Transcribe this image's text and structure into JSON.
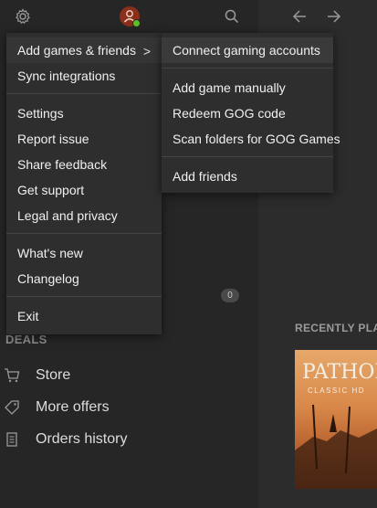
{
  "topbar": {
    "settings_icon": "gear-icon",
    "avatar_icon": "user-icon",
    "search_icon": "search-icon",
    "back_icon": "arrow-left-icon",
    "forward_icon": "arrow-right-icon"
  },
  "sidebar": {
    "badge_count": "0",
    "deals_label": "DEALS",
    "items": [
      {
        "label": "Store",
        "icon": "cart-icon"
      },
      {
        "label": "More offers",
        "icon": "tag-icon"
      },
      {
        "label": "Orders history",
        "icon": "receipt-icon"
      }
    ]
  },
  "main": {
    "recently_played_label": "RECENTLY PLA",
    "game_cover": {
      "title": "PATHOLOGI",
      "subtitle": "CLASSIC HD"
    }
  },
  "menu": {
    "items": [
      {
        "label": "Add games & friends",
        "submenu": true
      },
      {
        "label": "Sync integrations"
      },
      {
        "label": "Settings"
      },
      {
        "label": "Report issue"
      },
      {
        "label": "Share feedback"
      },
      {
        "label": "Get support"
      },
      {
        "label": "Legal and privacy"
      },
      {
        "label": "What's new"
      },
      {
        "label": "Changelog"
      },
      {
        "label": "Exit"
      }
    ],
    "chevron": ">"
  },
  "submenu": {
    "items": [
      {
        "label": "Connect gaming accounts"
      },
      {
        "label": "Add game manually"
      },
      {
        "label": "Redeem GOG code"
      },
      {
        "label": "Scan folders for GOG Games"
      },
      {
        "label": "Add friends"
      }
    ]
  },
  "colors": {
    "background": "#262626",
    "menu_bg": "#2e2e2e",
    "highlight": "#3a3a3a",
    "avatar": "#8a2f1a",
    "online": "#5fbf2b"
  }
}
